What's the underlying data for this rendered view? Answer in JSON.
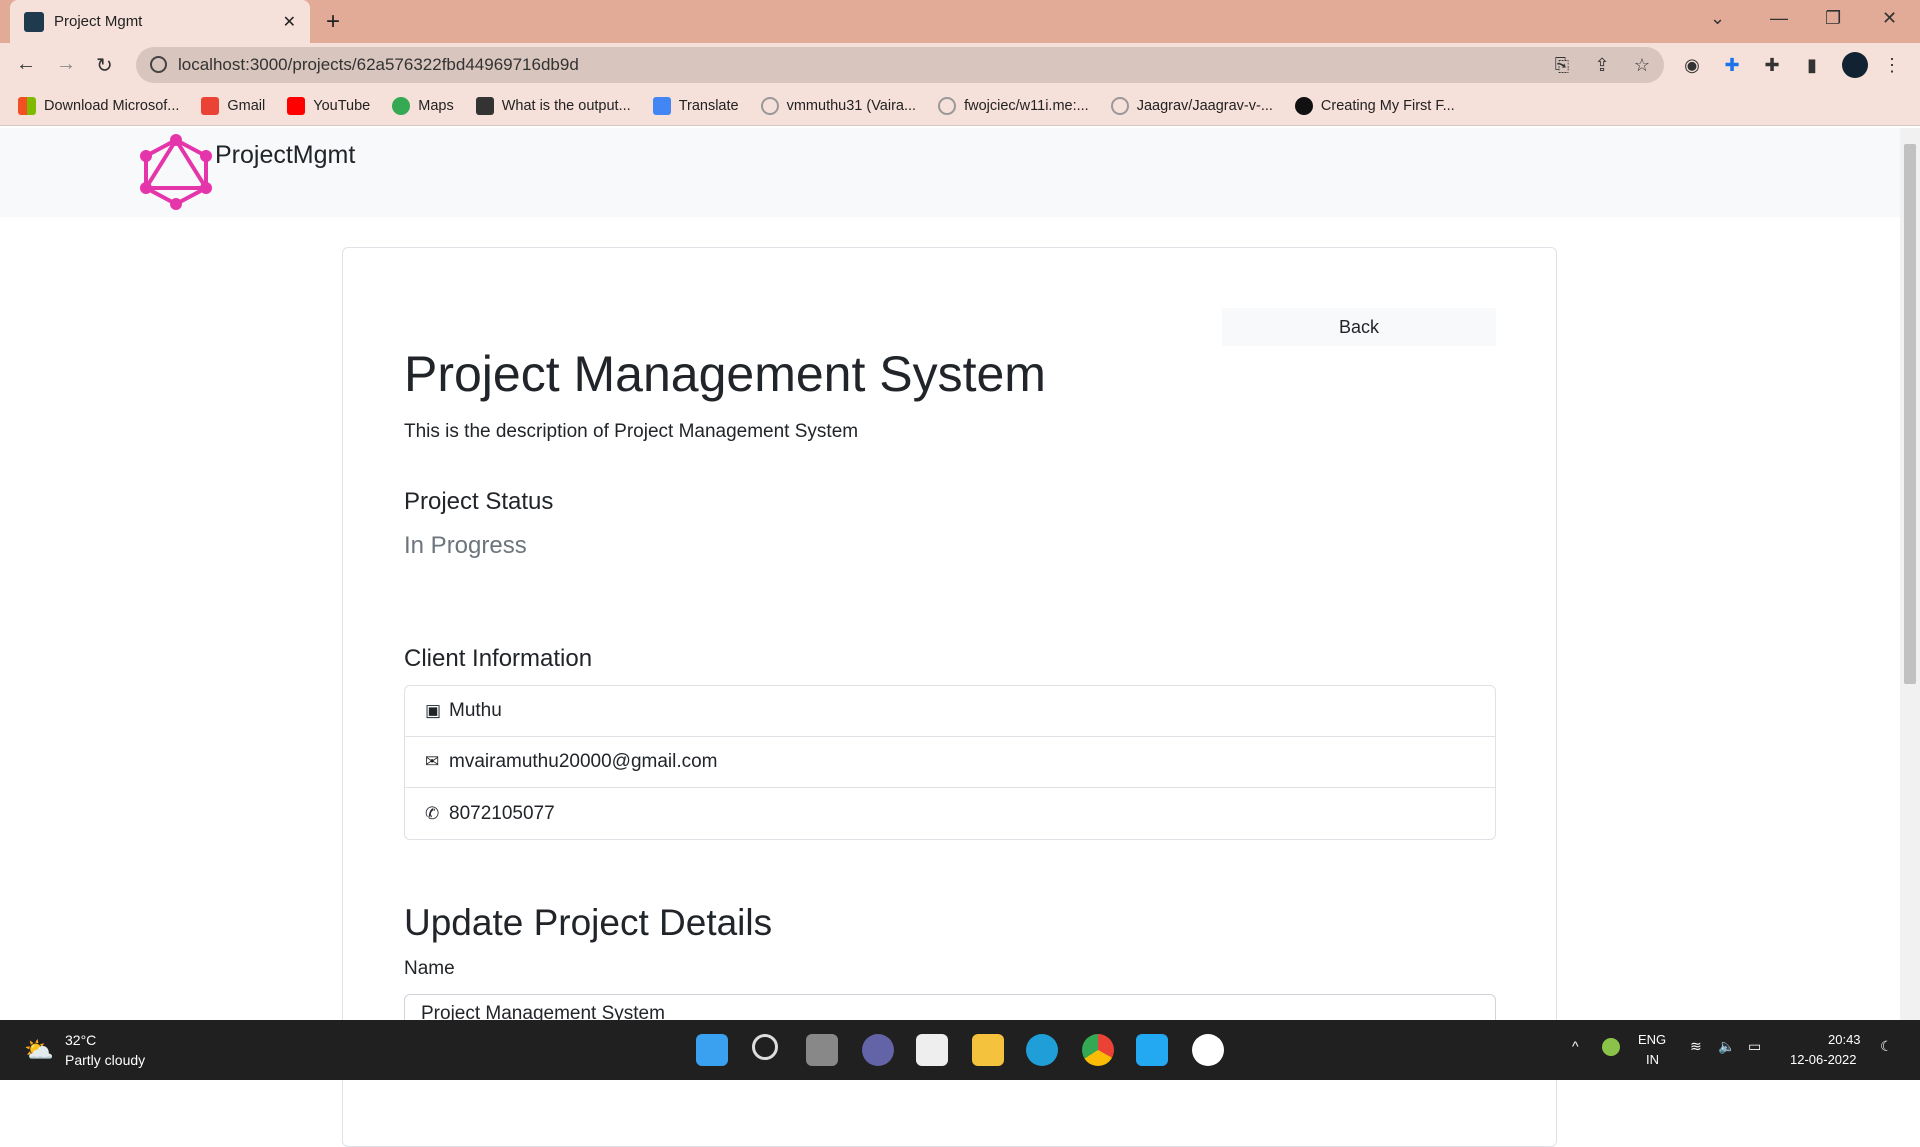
{
  "browser": {
    "tab_title": "Project Mgmt",
    "url": "localhost:3000/projects/62a576322fbd44969716db9d",
    "bookmarks": [
      "Download Microsof...",
      "Gmail",
      "YouTube",
      "Maps",
      "What is the output...",
      "Translate",
      "vmmuthu31 (Vaira...",
      "fwojciec/w11i.me:...",
      "Jaagrav/Jaagrav-v-...",
      "Creating My First F..."
    ]
  },
  "navbar": {
    "brand": "ProjectMgmt"
  },
  "page": {
    "back_label": "Back",
    "title": "Project Management System",
    "description": "This is the description of Project Management System",
    "status_heading": "Project Status",
    "status": "In Progress",
    "client_heading": "Client Information",
    "client": {
      "name": "Muthu",
      "email": "mvairamuthu20000@gmail.com",
      "phone": "8072105077"
    },
    "update_heading": "Update Project Details",
    "name_label": "Name",
    "name_value": "Project Management System"
  },
  "taskbar": {
    "temp": "32°C",
    "weather": "Partly cloudy",
    "lang": "ENG",
    "region": "IN",
    "time": "20:43",
    "date": "12-06-2022"
  }
}
